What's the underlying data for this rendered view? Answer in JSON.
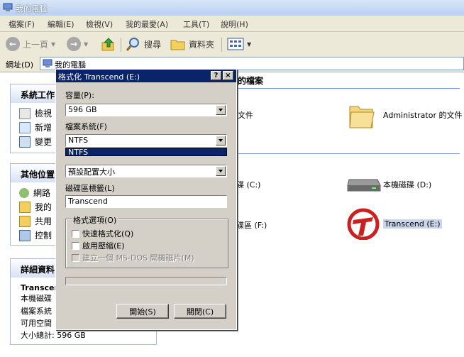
{
  "window": {
    "title": "我的電腦"
  },
  "menu": [
    "檔案(F)",
    "編輯(E)",
    "檢視(V)",
    "我的最愛(A)",
    "工具(T)",
    "說明(H)"
  ],
  "toolbar": {
    "back": "上一頁",
    "search": "搜尋",
    "folders": "資料夾"
  },
  "address": {
    "label": "網址(D)",
    "value": "我的電腦"
  },
  "left_panels": {
    "system_tasks": {
      "title": "系統工作",
      "items": [
        "檢視",
        "新增",
        "變更"
      ]
    },
    "other_places": {
      "title": "其他位置",
      "items": [
        "網路",
        "我的",
        "共用",
        "控制"
      ]
    },
    "details": {
      "title": "詳細資料",
      "name": "Transcen",
      "type": "本機磁碟",
      "fs": "檔案系統",
      "free": "可用空間",
      "total": "大小總計: 596 GB"
    }
  },
  "content": {
    "section_files": "上的檔案",
    "files_label_left": "文件",
    "admin_docs": "Administrator 的文件",
    "drive_c_partial": "碟 (C:)",
    "drive_d": "本機磁碟 (D:)",
    "drive_f_partial": "碟區 (F:)",
    "drive_e": "Transcend (E:)"
  },
  "dialog": {
    "title": "格式化 Transcend (E:)",
    "help_btn": "?",
    "close_btn": "×",
    "capacity_label": "容量(P):",
    "capacity_value": "596 GB",
    "fs_label": "檔案系統(F)",
    "fs_value": "NTFS",
    "fs_dropdown_item": "NTFS",
    "alloc_value": "預設配置大小",
    "volume_label": "磁碟區標籤(L)",
    "volume_value": "Transcend",
    "options_legend": "格式選項(O)",
    "opt_quick": "快速格式化(Q)",
    "opt_compress": "啟用壓縮(E)",
    "opt_msdos": "建立一個 MS-DOS 開機磁片(M)",
    "start_btn": "開始(S)",
    "close_button_label": "關閉(C)",
    "progress": 0
  },
  "colors": {
    "dialog_title_bg": "#0a246a",
    "face": "#d4d0c8",
    "window_title": "#b9cff0"
  }
}
